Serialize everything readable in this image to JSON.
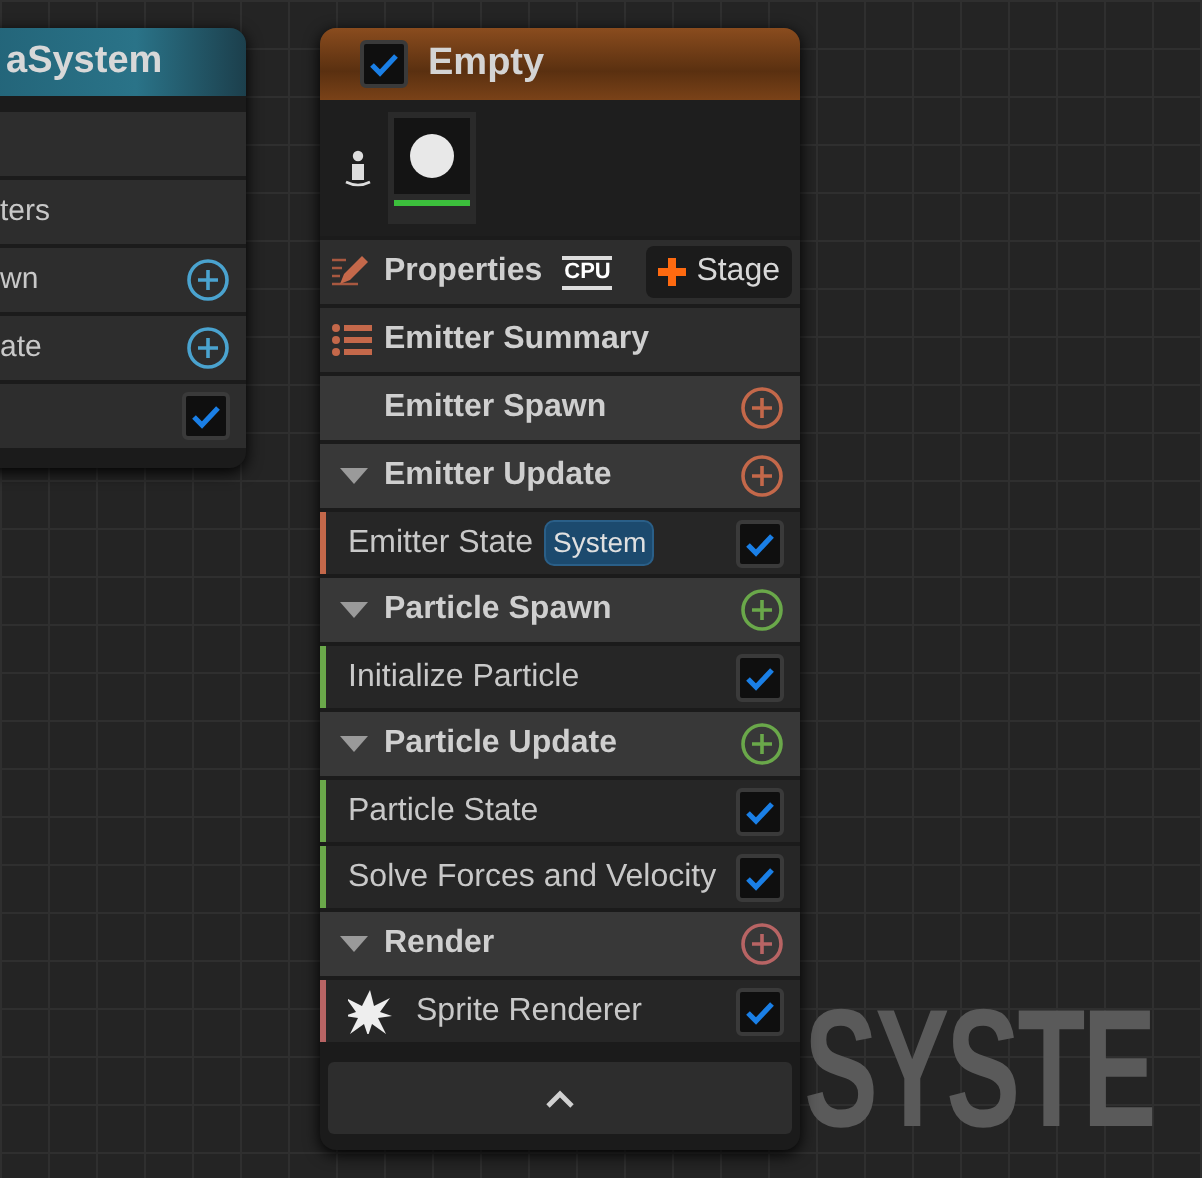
{
  "left_node": {
    "title": "aSystem",
    "rows": [
      {
        "kind": "blank"
      },
      {
        "kind": "text",
        "label": "ters"
      },
      {
        "kind": "add",
        "label": "wn",
        "color": "#4aa3cf"
      },
      {
        "kind": "add",
        "label": "ate",
        "color": "#4aa3cf"
      },
      {
        "kind": "check",
        "checked": true
      }
    ]
  },
  "emitter_node": {
    "title": "Empty",
    "enabled": true,
    "properties": {
      "label": "Properties",
      "sim_target": "CPU",
      "stage_button": "Stage"
    },
    "summary": "Emitter Summary",
    "sections": [
      {
        "label": "Emitter Spawn",
        "color": "#c4684a"
      },
      {
        "label": "Emitter Update",
        "color": "#c4684a",
        "modules": [
          {
            "kind": "module",
            "label": "Emitter State",
            "tag": "System",
            "checked": true
          }
        ]
      },
      {
        "label": "Particle Spawn",
        "color": "#6aa84a",
        "modules": [
          {
            "kind": "module",
            "label": "Initialize Particle",
            "checked": true
          }
        ]
      },
      {
        "label": "Particle Update",
        "color": "#6aa84a",
        "modules": [
          {
            "kind": "module",
            "label": "Particle State",
            "checked": true
          },
          {
            "kind": "module",
            "label": "Solve Forces and Velocity",
            "checked": true
          }
        ]
      },
      {
        "label": "Render",
        "color": "#b86464",
        "modules": [
          {
            "kind": "renderer",
            "label": "Sprite Renderer",
            "checked": true
          }
        ]
      }
    ]
  },
  "graph_label": "SYSTE"
}
